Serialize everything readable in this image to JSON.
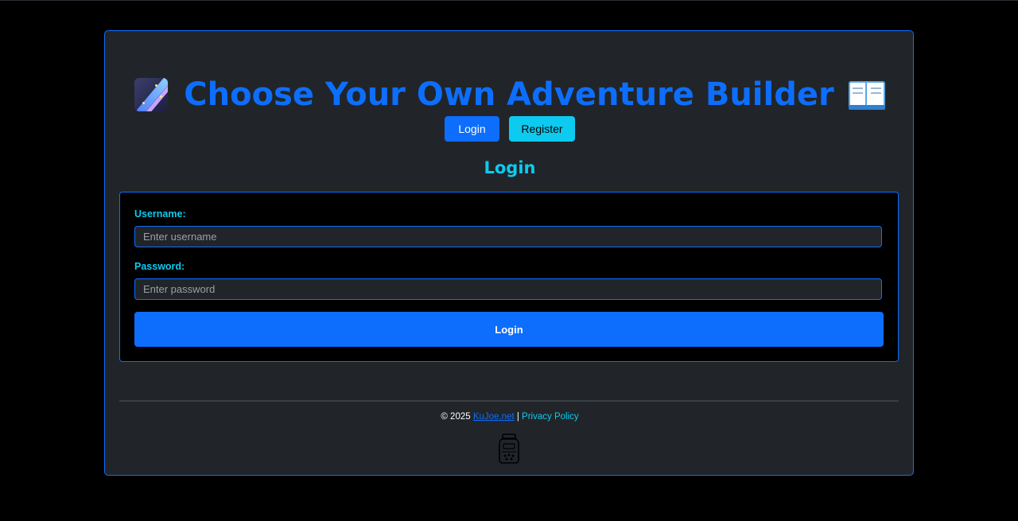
{
  "header": {
    "title": "Choose Your Own Adventure Builder",
    "left_icon": "shooting-star-icon",
    "right_icon": "open-book-icon",
    "title_color": "#0d6efd"
  },
  "nav": {
    "login_label": "Login",
    "register_label": "Register"
  },
  "form": {
    "heading": "Login",
    "username_label": "Username:",
    "username_placeholder": "Enter username",
    "username_value": "",
    "password_label": "Password:",
    "password_placeholder": "Enter password",
    "password_value": "",
    "submit_label": "Login"
  },
  "footer": {
    "copyright": "© 2025",
    "site_link": "KuJoe.net",
    "separator": "|",
    "privacy_link": "Privacy Policy",
    "logo_icon": "jar-icon"
  },
  "colors": {
    "primary": "#0d6efd",
    "info": "#0dcaf0",
    "panel": "#212529",
    "background": "#000000"
  }
}
